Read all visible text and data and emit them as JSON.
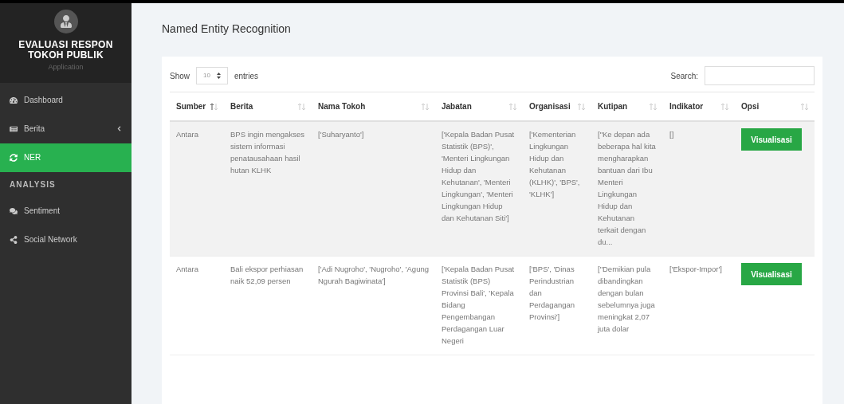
{
  "sidebar": {
    "title": "EVALUASI RESPON TOKOH PUBLIK",
    "subtitle": "Application",
    "items": [
      {
        "kind": "link",
        "label": "Dashboard",
        "selected": false
      },
      {
        "kind": "submenu",
        "label": "Berita",
        "selected": false
      },
      {
        "kind": "link",
        "label": "NER",
        "selected": true
      },
      {
        "kind": "header",
        "label": "ANALYSIS"
      },
      {
        "kind": "link",
        "label": "Sentiment",
        "selected": false
      },
      {
        "kind": "link",
        "label": "Social Network",
        "selected": false
      }
    ]
  },
  "page_title": "Named Entity Recognition",
  "length_control": {
    "label_before": "Show",
    "value": "10",
    "label_after": "entries"
  },
  "search": {
    "label": "Search:"
  },
  "table": {
    "columns": [
      {
        "label": "Sumber",
        "selected": true
      },
      {
        "label": "Berita",
        "selected": false
      },
      {
        "label": "Nama Tokoh",
        "selected": false
      },
      {
        "label": "Jabatan",
        "selected": false
      },
      {
        "label": "Organisasi",
        "selected": false
      },
      {
        "label": "Kutipan",
        "selected": false
      },
      {
        "label": "Indikator",
        "selected": false
      },
      {
        "label": "Opsi",
        "selected": false
      }
    ],
    "rows": [
      {
        "cells": [
          "Antara",
          "BPS ingin mengakses sistem informasi penatausahaan hasil hutan KLHK",
          "['Suharyanto']",
          "['Kepala Badan Pusat Statistik (BPS)', 'Menteri Lingkungan Hidup dan Kehutanan', 'Menteri Lingkungan', 'Menteri Lingkungan Hidup dan Kehutanan Siti']",
          "['Kementerian Lingkungan Hidup dan Kehutanan (KLHK)', 'BPS', 'KLHK']",
          "[\"Ke depan ada beberapa hal kita mengharapkan bantuan dari Ibu Menteri Lingkungan Hidup dan Kehutanan terkait dengan du...",
          "[]"
        ],
        "action": "Visualisasi"
      },
      {
        "cells": [
          "Antara",
          "Bali ekspor perhiasan naik 52,09 persen",
          "['Adi Nugroho', 'Nugroho', 'Agung Ngurah Bagiwinata']",
          "['Kepala Badan Pusat Statistik (BPS) Provinsi Bali', 'Kepala Bidang Pengembangan Perdagangan Luar Negeri",
          "['BPS', 'Dinas Perindustrian dan Perdagangan Provinsi']",
          "[\"Demikian pula dibandingkan dengan bulan sebelumnya juga meningkat 2,07 juta dolar",
          "['Ekspor-Impor']"
        ],
        "action": "Visualisasi"
      }
    ]
  }
}
